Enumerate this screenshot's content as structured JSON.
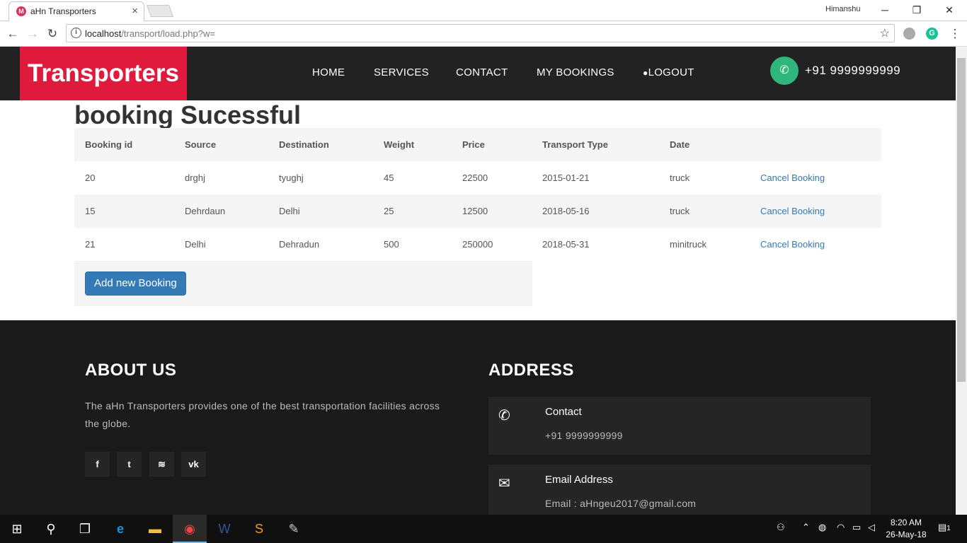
{
  "browser": {
    "tab_title": "aHn Transporters",
    "tab_close": "×",
    "favicon_letter": "M",
    "user": "Himanshu",
    "minimize": "─",
    "maximize": "❐",
    "close": "✕",
    "url": "localhost/transport/load.php?w=",
    "url_prefix": "localhost",
    "url_path": "/transport/load.php?w="
  },
  "navbar": {
    "brand": "Transporters",
    "links": [
      "HOME",
      "SERVICES",
      "CONTACT",
      "MY BOOKINGS",
      "LOGOUT"
    ],
    "phone": "+91 9999999999"
  },
  "main": {
    "heading": "booking Sucessful",
    "table_headers": [
      "Booking id",
      "Source",
      "Destination",
      "Weight",
      "Price",
      "Transport Type",
      "Date"
    ],
    "rows": [
      {
        "id": "20",
        "source": "drghj",
        "destination": "tyughj",
        "weight": "45",
        "price": "22500",
        "type": "2015-01-21",
        "date": "truck",
        "action": "Cancel Booking"
      },
      {
        "id": "15",
        "source": "Dehrdaun",
        "destination": "Delhi",
        "weight": "25",
        "price": "12500",
        "type": "2018-05-16",
        "date": "truck",
        "action": "Cancel Booking"
      },
      {
        "id": "21",
        "source": "Delhi",
        "destination": "Dehradun",
        "weight": "500",
        "price": "250000",
        "type": "2018-05-31",
        "date": "minitruck",
        "action": "Cancel Booking"
      }
    ],
    "add_button": "Add new Booking"
  },
  "footer": {
    "about_title": "ABOUT US",
    "about_text": "The aHn Transporters provides one of the best transportation facilities across the globe.",
    "social": [
      "f",
      "t",
      "rss",
      "vk"
    ],
    "address_title": "ADDRESS",
    "contact_label": "Contact",
    "contact_value": "+91 9999999999",
    "email_label": "Email Address",
    "email_value": "Email : aHngeu2017@gmail.com"
  },
  "taskbar": {
    "time": "8:20 AM",
    "date": "26-May-18",
    "notification_count": "1"
  }
}
